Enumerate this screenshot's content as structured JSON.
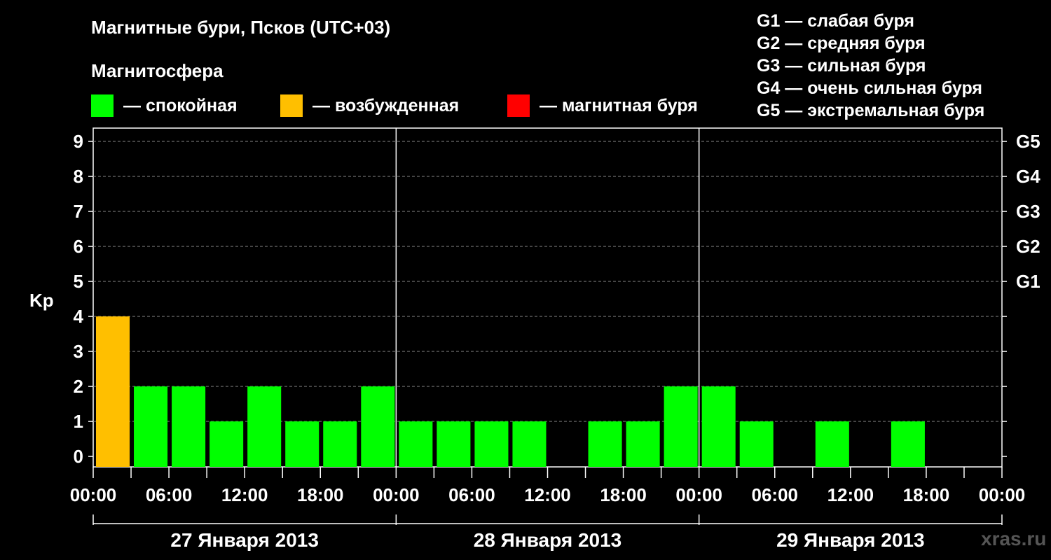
{
  "title": "Магнитные бури, Псков (UTC+03)",
  "magnetosphere_label": "Магнитосфера",
  "legend": [
    {
      "label": "— спокойная",
      "color": "#00ff00"
    },
    {
      "label": "— возбужденная",
      "color": "#ffbf00"
    },
    {
      "label": "— магнитная буря",
      "color": "#ff0000"
    }
  ],
  "storm_scale": [
    "G1 — слабая буря",
    "G2 — средняя буря",
    "G3 — сильная буря",
    "G4 — очень сильная буря",
    "G5 — экстремальная буря"
  ],
  "credit": "xras.ru",
  "chart_data": {
    "type": "bar",
    "ylabel": "Kp",
    "ylim": [
      0,
      9
    ],
    "yticks": [
      "0",
      "1",
      "2",
      "3",
      "4",
      "5",
      "6",
      "7",
      "8",
      "9"
    ],
    "right_ticks": [
      {
        "kp": 5,
        "label": "G1"
      },
      {
        "kp": 6,
        "label": "G2"
      },
      {
        "kp": 7,
        "label": "G3"
      },
      {
        "kp": 8,
        "label": "G4"
      },
      {
        "kp": 9,
        "label": "G5"
      }
    ],
    "grid": true,
    "x_tick_labels": [
      "00:00",
      "06:00",
      "12:00",
      "18:00",
      "00:00",
      "06:00",
      "12:00",
      "18:00",
      "00:00",
      "06:00",
      "12:00",
      "18:00",
      "00:00"
    ],
    "days": [
      "27 Января 2013",
      "28 Января 2013",
      "29 Января 2013"
    ],
    "interval_hours": 3,
    "values": [
      4,
      2,
      2,
      1,
      2,
      1,
      1,
      2,
      1,
      1,
      1,
      1,
      0,
      1,
      1,
      2,
      2,
      1,
      0,
      1,
      0,
      1,
      0,
      0
    ],
    "colors": [
      "#ffbf00",
      "#00ff00",
      "#00ff00",
      "#00ff00",
      "#00ff00",
      "#00ff00",
      "#00ff00",
      "#00ff00",
      "#00ff00",
      "#00ff00",
      "#00ff00",
      "#00ff00",
      "#00ff00",
      "#00ff00",
      "#00ff00",
      "#00ff00",
      "#00ff00",
      "#00ff00",
      "#00ff00",
      "#00ff00",
      "#00ff00",
      "#00ff00",
      "#00ff00",
      "#00ff00"
    ]
  }
}
